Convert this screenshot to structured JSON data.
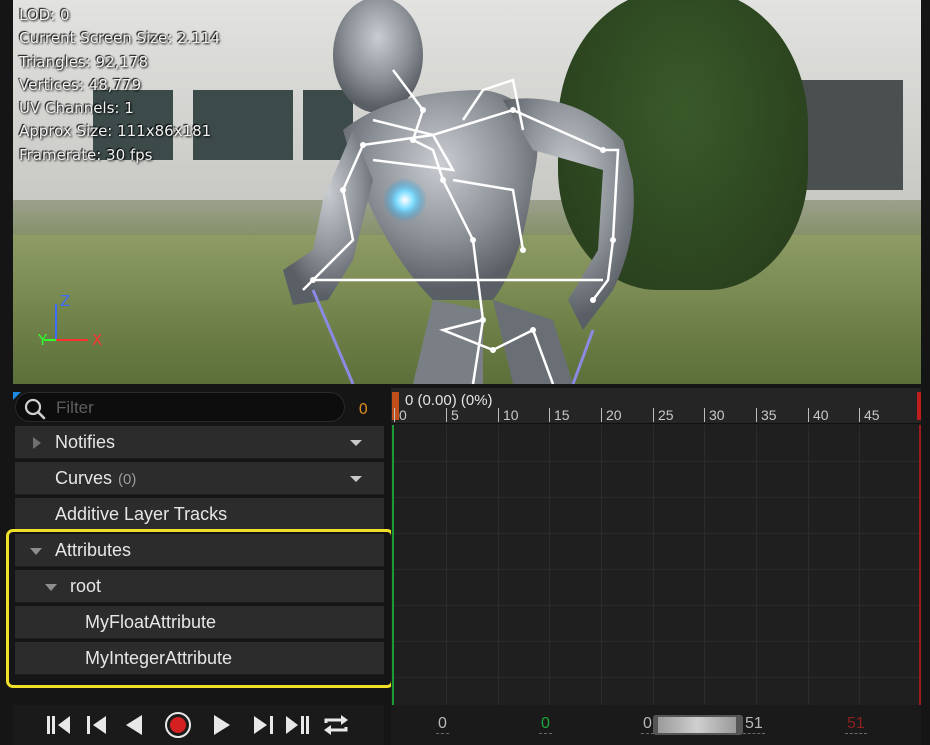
{
  "viewport": {
    "stats": [
      "LOD: 0",
      "Current Screen Size: 2.114",
      "Triangles: 92,178",
      "Vertices: 48,779",
      "UV Channels: 1",
      "Approx Size: 111x86x181",
      "Framerate: 30 fps"
    ],
    "axes": {
      "z": "Z",
      "y": "Y",
      "x": "X"
    }
  },
  "tracks": {
    "filter": {
      "placeholder": "Filter",
      "count": "0"
    },
    "rows": {
      "notifies": "Notifies",
      "curves": "Curves",
      "curves_count": "(0)",
      "additive": "Additive Layer Tracks",
      "attributes": "Attributes",
      "root": "root",
      "float_attr": "MyFloatAttribute",
      "int_attr": "MyIntegerAttribute"
    }
  },
  "timeline": {
    "header": "0 (0.00) (0%)",
    "ticks": [
      "0",
      "5",
      "10",
      "15",
      "20",
      "25",
      "30",
      "35",
      "40",
      "45"
    ]
  },
  "frames": {
    "start": "0",
    "current": "0",
    "range_start": "0",
    "range_end": "51",
    "end": "51"
  },
  "colors": {
    "highlight": "#f0e02a",
    "filter_count": "#d98c1f",
    "playhead": "#1a9a34",
    "end_marker": "#c01d1d",
    "record": "#d42020"
  }
}
